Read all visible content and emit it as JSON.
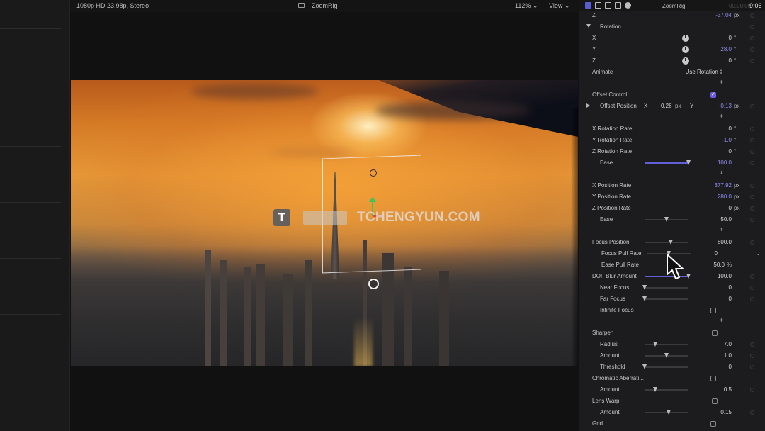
{
  "viewer": {
    "format": "1080p HD 23.98p, Stereo",
    "project_name": "ZoomRig",
    "zoom": "112%",
    "view_label": "View",
    "watermark_logo": "T",
    "watermark_text": "TCHENGYUN.COM"
  },
  "inspector": {
    "title": "ZoomRig",
    "duration": "00:00:00",
    "clock": "9:06",
    "rows": {
      "z_pos": {
        "label": "Z",
        "value": "-37.04",
        "unit": "px"
      },
      "rotation": {
        "label": "Rotation"
      },
      "rot_x": {
        "label": "X",
        "value": "0",
        "unit": "°"
      },
      "rot_y": {
        "label": "Y",
        "value": "28.0",
        "unit": "°"
      },
      "rot_z": {
        "label": "Z",
        "value": "0",
        "unit": "°"
      },
      "animate": {
        "label": "Animate",
        "value": "Use Rotation ◊"
      },
      "offset_control": {
        "label": "Offset Control",
        "checked": true
      },
      "offset_position": {
        "label": "Offset Position",
        "x_label": "X",
        "x_value": "0.26",
        "x_unit": "px",
        "y_label": "Y",
        "y_value": "-0.13",
        "y_unit": "px"
      },
      "x_rot_rate": {
        "label": "X Rotation Rate",
        "value": "0",
        "unit": "°"
      },
      "y_rot_rate": {
        "label": "Y Rotation Rate",
        "value": "-1.0",
        "unit": "°"
      },
      "z_rot_rate": {
        "label": "Z Rotation Rate",
        "value": "0",
        "unit": "°"
      },
      "ease1": {
        "label": "Ease",
        "value": "100.0",
        "level": 1.0
      },
      "x_pos_rate": {
        "label": "X Position Rate",
        "value": "377.92",
        "unit": "px"
      },
      "y_pos_rate": {
        "label": "Y Position Rate",
        "value": "280.0",
        "unit": "px"
      },
      "z_pos_rate": {
        "label": "Z Position Rate",
        "value": "0",
        "unit": "px"
      },
      "ease2": {
        "label": "Ease",
        "value": "50.0",
        "level": 0.5
      },
      "focus_position": {
        "label": "Focus Position",
        "value": "800.0",
        "level": 0.6
      },
      "focus_pull_rate": {
        "label": "Focus Pull Rate",
        "value": "0",
        "level": 0.5
      },
      "ease_pull_rate": {
        "label": "Ease Pull Rate",
        "value": "50.0",
        "unit": "%"
      },
      "dof_blur": {
        "label": "DOF Blur Amount",
        "value": "100.0",
        "level": 1.0
      },
      "near_focus": {
        "label": "Near Focus",
        "value": "0",
        "level": 0.0
      },
      "far_focus": {
        "label": "Far Focus",
        "value": "0",
        "level": 0.0
      },
      "infinite_focus": {
        "label": "Infinite Focus",
        "checked": false
      },
      "sharpen": {
        "label": "Sharpen",
        "checked": false
      },
      "radius": {
        "label": "Radius",
        "value": "7.0",
        "level": 0.25
      },
      "amount1": {
        "label": "Amount",
        "value": "1.0",
        "level": 0.5
      },
      "threshold": {
        "label": "Threshold",
        "value": "0",
        "level": 0.0
      },
      "chromatic": {
        "label": "Chromatic Aberrati...",
        "checked": false
      },
      "amount2": {
        "label": "Amount",
        "value": "0.5",
        "level": 0.25
      },
      "lens_warp": {
        "label": "Lens Warp",
        "checked": false
      },
      "amount3": {
        "label": "Amount",
        "value": "0.15",
        "level": 0.55
      },
      "grid": {
        "label": "Grid",
        "checked": false
      }
    }
  },
  "colors": {
    "accent": "#6b5ce7",
    "value_blue": "#8d8cf0",
    "inspector_bg": "#1c1c1e"
  }
}
